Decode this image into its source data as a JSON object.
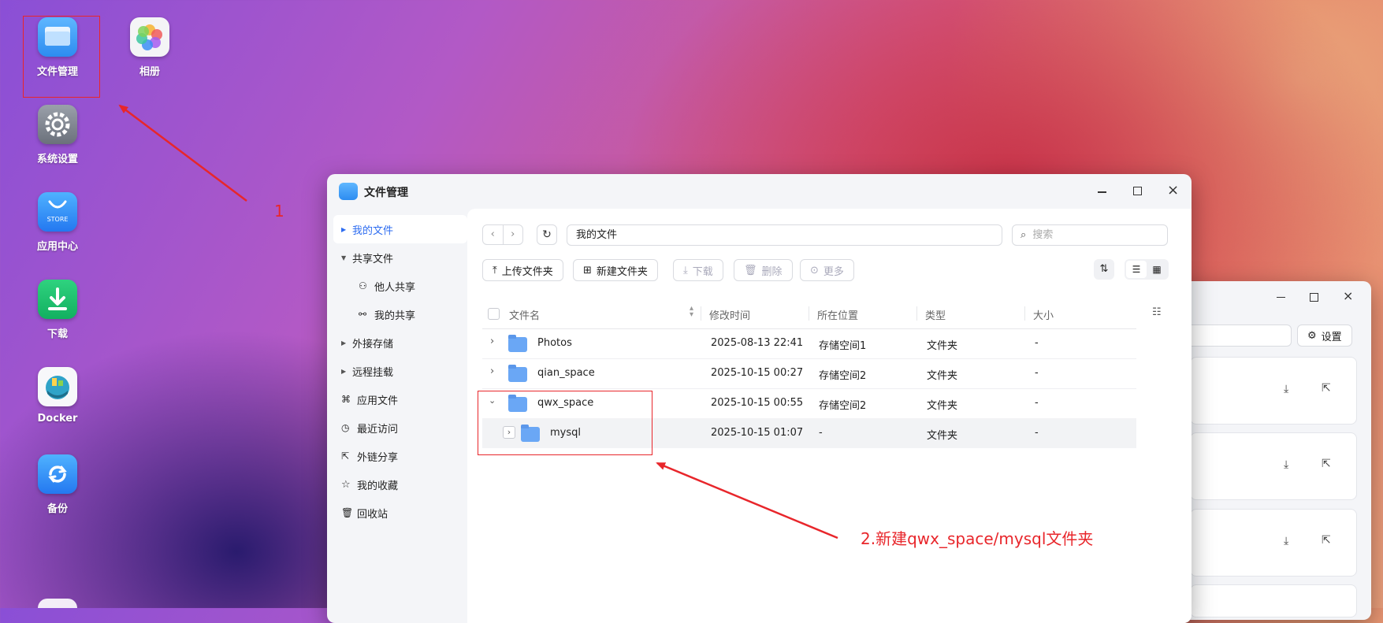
{
  "desktop": {
    "icons": [
      {
        "label": "文件管理",
        "icon": "folder-icon"
      },
      {
        "label": "相册",
        "icon": "photos-icon"
      },
      {
        "label": "系统设置",
        "icon": "gear-icon"
      },
      {
        "label": "应用中心",
        "icon": "store-icon",
        "badge": "STORE"
      },
      {
        "label": "下载",
        "icon": "download-icon"
      },
      {
        "label": "Docker",
        "icon": "docker-icon"
      },
      {
        "label": "备份",
        "icon": "backup-icon"
      }
    ]
  },
  "window": {
    "title": "文件管理",
    "sidebar": {
      "items": [
        {
          "label": "我的文件"
        },
        {
          "label": "共享文件"
        },
        {
          "label": "他人共享"
        },
        {
          "label": "我的共享"
        },
        {
          "label": "外接存储"
        },
        {
          "label": "远程挂载"
        },
        {
          "label": "应用文件"
        },
        {
          "label": "最近访问"
        },
        {
          "label": "外链分享"
        },
        {
          "label": "我的收藏"
        },
        {
          "label": "回收站"
        }
      ]
    },
    "path": "我的文件",
    "search_placeholder": "搜索",
    "toolbar": {
      "upload": "上传文件夹",
      "new_folder": "新建文件夹",
      "download": "下载",
      "delete": "删除",
      "more": "更多"
    },
    "columns": {
      "name": "文件名",
      "modified": "修改时间",
      "location": "所在位置",
      "type": "类型",
      "size": "大小"
    },
    "rows": [
      {
        "name": "Photos",
        "modified": "2025-08-13 22:41",
        "location": "存储空间1",
        "type": "文件夹",
        "size": "-"
      },
      {
        "name": "qian_space",
        "modified": "2025-10-15 00:27",
        "location": "存储空间2",
        "type": "文件夹",
        "size": "-"
      },
      {
        "name": "qwx_space",
        "modified": "2025-10-15 00:55",
        "location": "存储空间2",
        "type": "文件夹",
        "size": "-"
      },
      {
        "name": "mysql",
        "modified": "2025-10-15 01:07",
        "location": "-",
        "type": "文件夹",
        "size": "-"
      }
    ]
  },
  "background_window": {
    "settings_label": "设置"
  },
  "annotations": {
    "step1": "1",
    "step2": "2.新建qwx_space/mysql文件夹",
    "color": "#e8262b"
  }
}
